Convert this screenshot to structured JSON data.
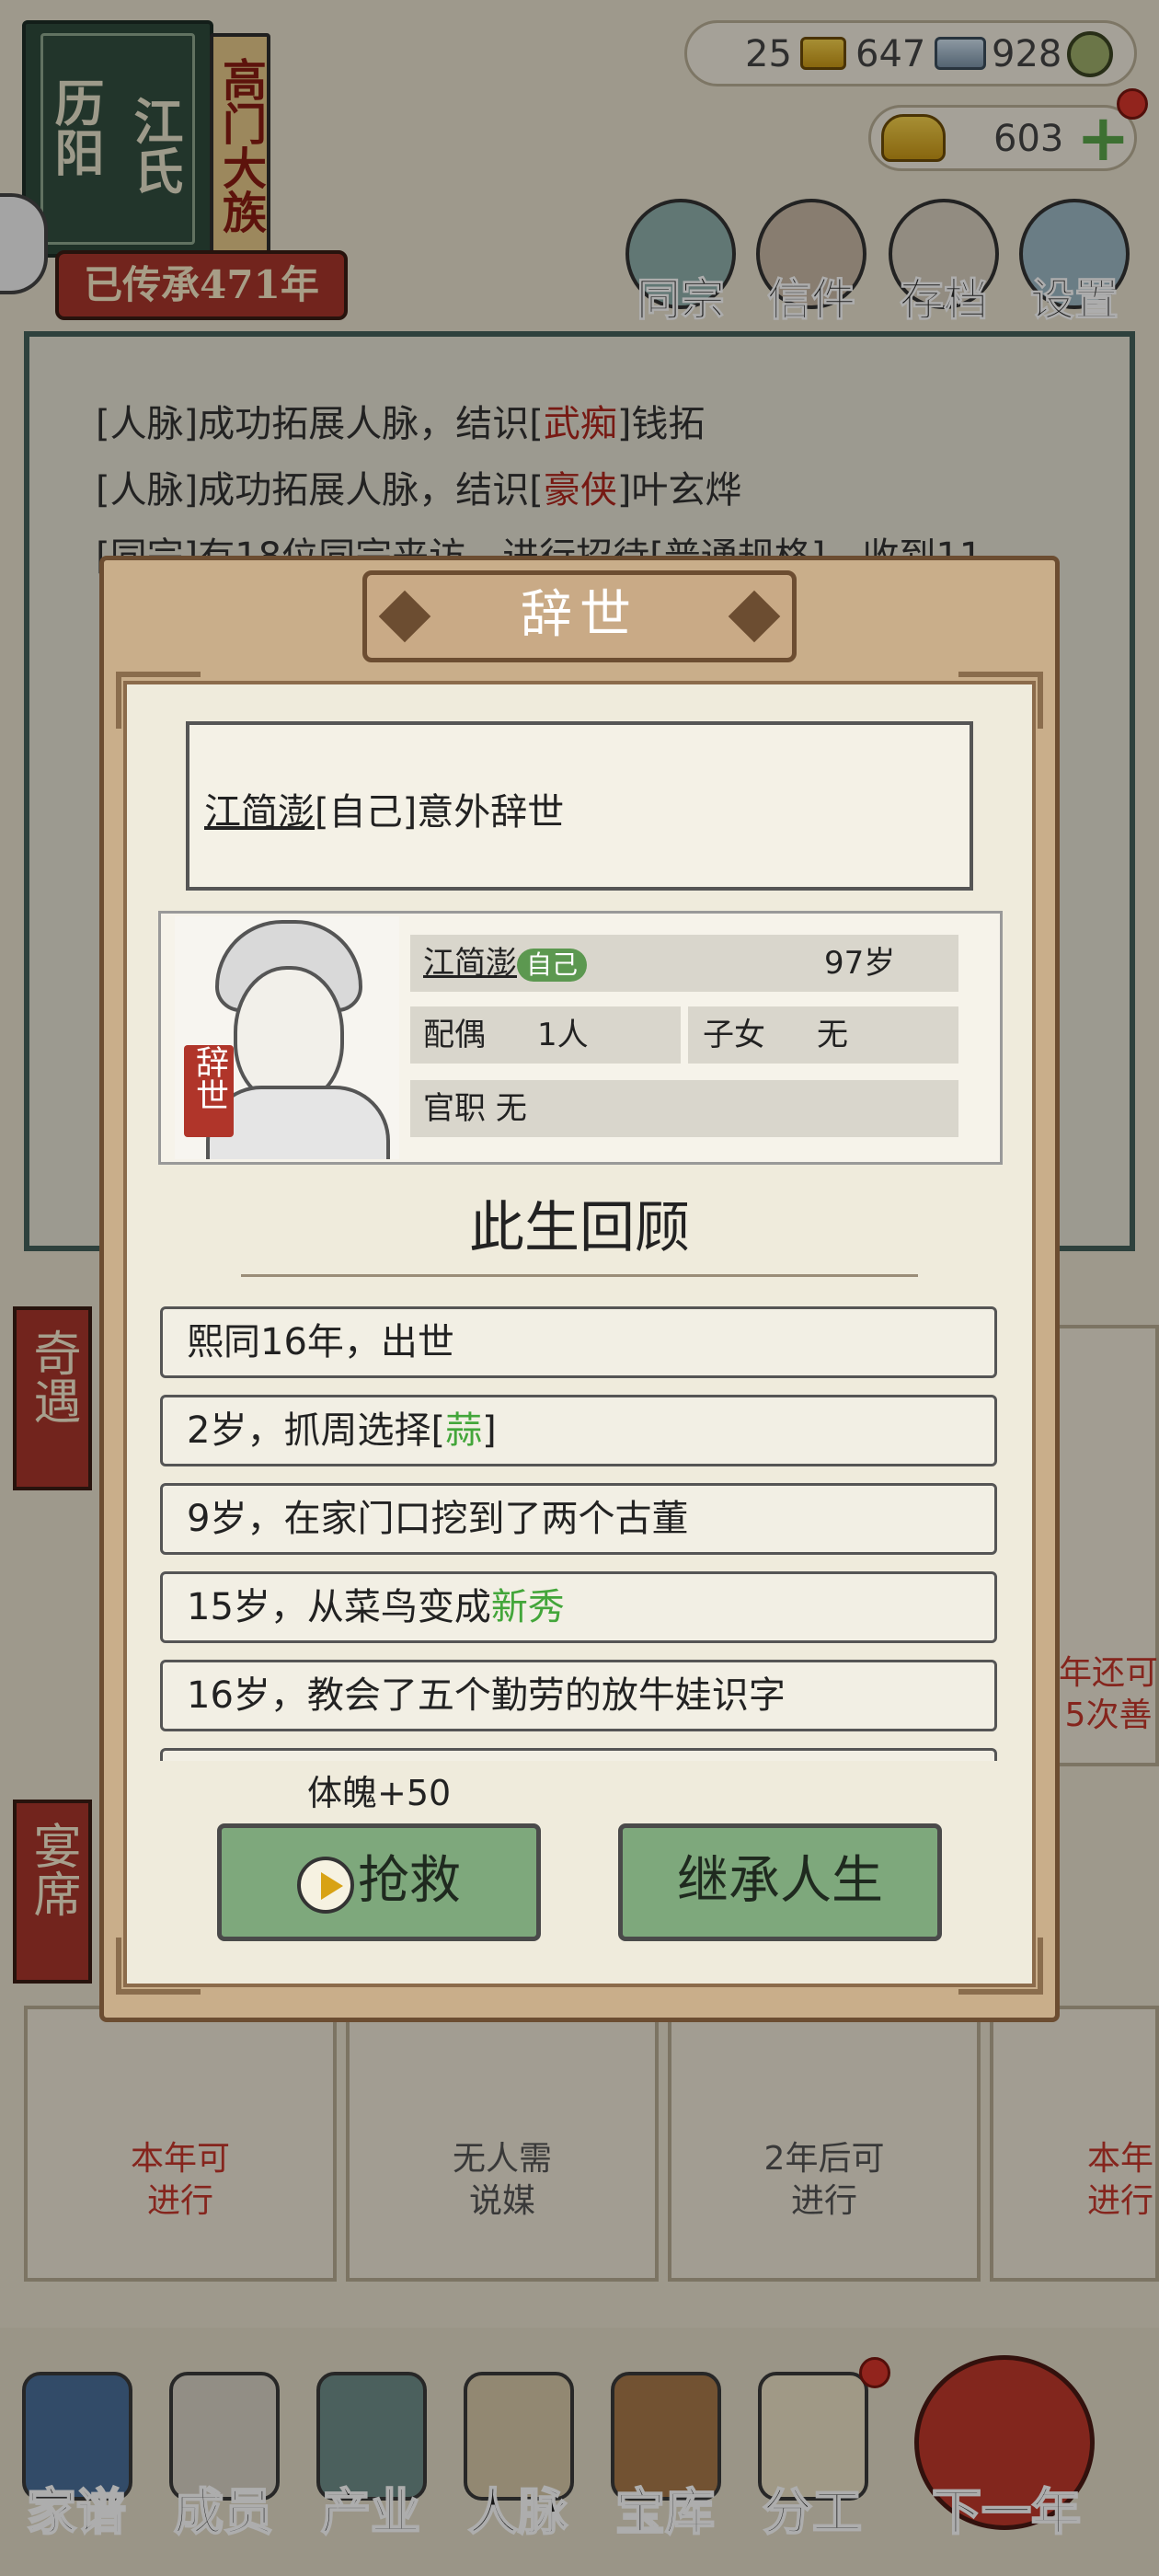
{
  "clan": {
    "location": "历阳",
    "surname": "江氏",
    "rank": "高门大族",
    "inherited": "已传承471年"
  },
  "currency": {
    "gold_bars": "25",
    "silver_bars": "647",
    "coins": "928",
    "ingots": "603"
  },
  "top_nav": [
    {
      "label": "同宗",
      "icon": "clan-book-icon"
    },
    {
      "label": "信件",
      "icon": "letter-icon"
    },
    {
      "label": "存档",
      "icon": "save-scroll-icon"
    },
    {
      "label": "设置",
      "icon": "gear-icon"
    }
  ],
  "log": {
    "lines": [
      {
        "prefix": "[人脉]成功拓展人脉，结识[",
        "tag": "武痴",
        "suffix": "]钱拓"
      },
      {
        "prefix": "[人脉]成功拓展人脉，结识[",
        "tag": "豪侠",
        "suffix": "]叶玄烨"
      },
      {
        "prefix": "[同宗]有18位同宗来访，进行招待[普通规格]，收到11",
        "tag": "",
        "suffix": ""
      }
    ]
  },
  "side_tags": {
    "encounter": "奇遇",
    "banquet": "宴席"
  },
  "bg_cards": {
    "right_partial": "年还可\n5次善",
    "card1": "本年可\n进行",
    "card2": "无人需\n说媒",
    "card3": "2年后可\n进行",
    "card4": "本年\n进行"
  },
  "bottom_nav": [
    {
      "label": "家谱",
      "icon": "genealogy-book-icon"
    },
    {
      "label": "成员",
      "icon": "member-icon"
    },
    {
      "label": "产业",
      "icon": "estate-icon"
    },
    {
      "label": "人脉",
      "icon": "network-icon"
    },
    {
      "label": "宝库",
      "icon": "treasure-chest-icon"
    },
    {
      "label": "分工",
      "icon": "scroll-icon"
    },
    {
      "label": "下一年",
      "icon": "lantern-icon"
    }
  ],
  "modal": {
    "title": "辞世",
    "message": {
      "name": "江简澎",
      "suffix": "[自己]意外辞世"
    },
    "person": {
      "name": "江简澎",
      "self_badge": "自己",
      "age": "97岁",
      "spouse_label": "配偶",
      "spouse_value": "1人",
      "children_label": "子女",
      "children_value": "无",
      "office_label": "官职",
      "office_value": "无",
      "status_seal": "辞世"
    },
    "review_title": "此生回顾",
    "review": [
      {
        "text": "熙同16年，出世",
        "hl": "",
        "after": ""
      },
      {
        "text": "2岁，抓周选择[",
        "hl": "蒜",
        "after": "]"
      },
      {
        "text": "9岁，在家门口挖到了两个古董",
        "hl": "",
        "after": ""
      },
      {
        "text": "15岁，从菜鸟变成",
        "hl": "新秀",
        "after": ""
      },
      {
        "text": "16岁，教会了五个勤劳的放牛娃识字",
        "hl": "",
        "after": ""
      }
    ],
    "bonus": "体魄+50",
    "rescue_button": "抢救",
    "inherit_button": "继承人生"
  }
}
